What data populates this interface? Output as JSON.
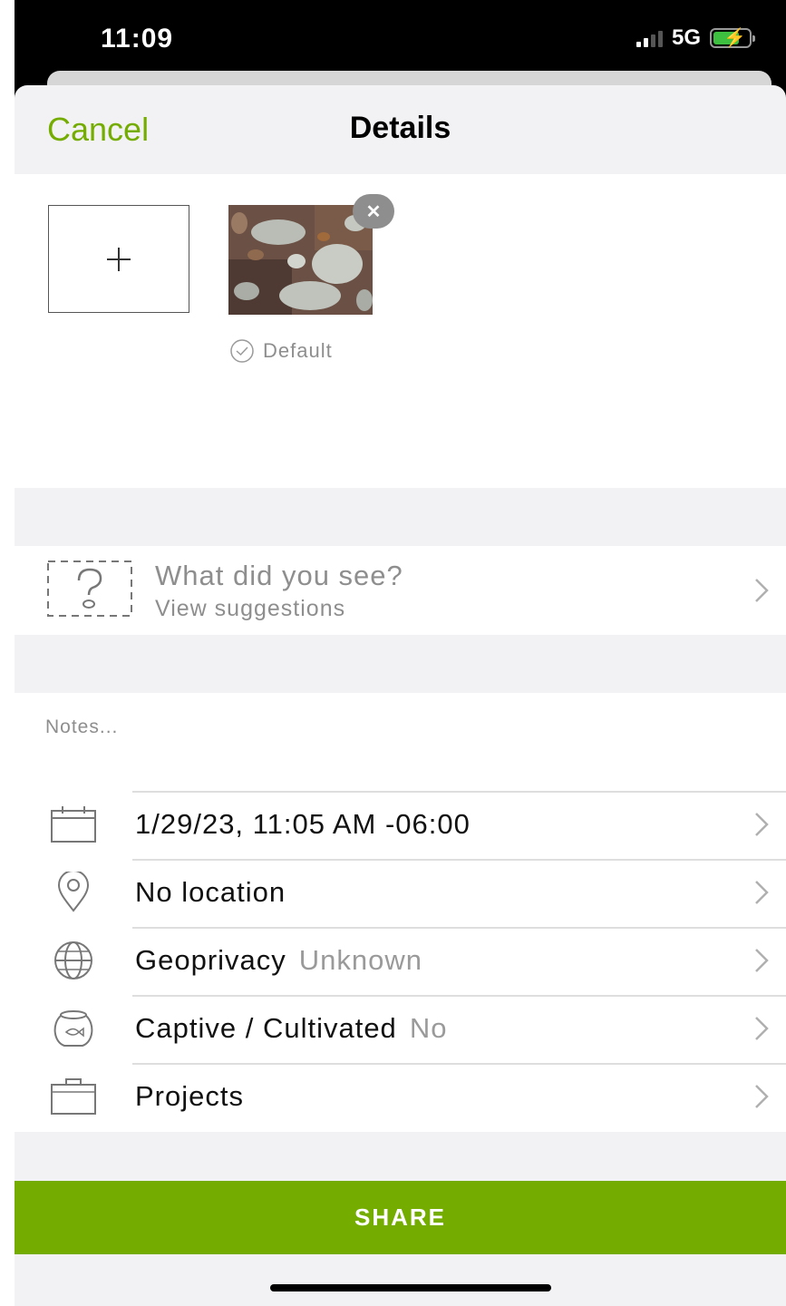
{
  "status_bar": {
    "time": "11:09",
    "network": "5G",
    "battery_charging": true
  },
  "nav": {
    "cancel_label": "Cancel",
    "title": "Details"
  },
  "photos": {
    "add_icon": "plus-icon",
    "remove_icon": "close-icon",
    "default_label": "Default"
  },
  "species": {
    "icon": "question-mark-icon",
    "prompt": "What did you see?",
    "suggestions": "View suggestions"
  },
  "notes": {
    "placeholder": "Notes..."
  },
  "rows": [
    {
      "icon": "calendar-icon",
      "label": "1/29/23, 11:05 AM -06:00",
      "value": ""
    },
    {
      "icon": "location-pin-icon",
      "label": "No location",
      "value": ""
    },
    {
      "icon": "globe-icon",
      "label": "Geoprivacy",
      "value": "Unknown"
    },
    {
      "icon": "fishbowl-icon",
      "label": "Captive / Cultivated",
      "value": "No"
    },
    {
      "icon": "briefcase-icon",
      "label": "Projects",
      "value": ""
    }
  ],
  "share": {
    "label": "SHARE"
  },
  "colors": {
    "accent": "#74ac00",
    "background": "#f2f2f4",
    "secondary_text": "#8e8e8e"
  }
}
